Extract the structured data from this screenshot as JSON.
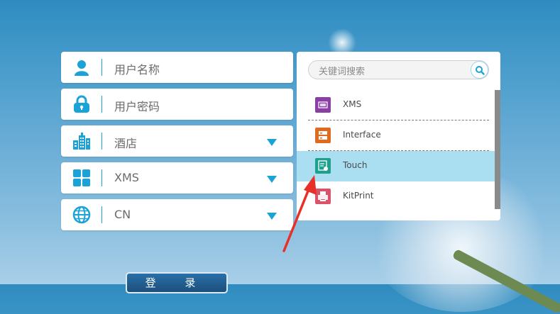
{
  "form": {
    "username_placeholder": "用户名称",
    "password_placeholder": "用户密码",
    "hotel_value": "酒店",
    "system_value": "XMS",
    "language_value": "CN",
    "login_label": "登 录"
  },
  "dropdown": {
    "search_placeholder": "关键词搜索",
    "items": [
      {
        "label": "XMS",
        "icon": "xms-app-icon",
        "color": "#8b3fa5"
      },
      {
        "label": "Interface",
        "icon": "interface-app-icon",
        "color": "#e06a1e"
      },
      {
        "label": "Touch",
        "icon": "touch-app-icon",
        "color": "#1ea08e",
        "selected": true
      },
      {
        "label": "KitPrint",
        "icon": "kitprint-app-icon",
        "color": "#d9536a"
      }
    ]
  },
  "colors": {
    "accent": "#1ba3d8",
    "selection": "#aadff2",
    "annotation_arrow": "#e8302a"
  }
}
